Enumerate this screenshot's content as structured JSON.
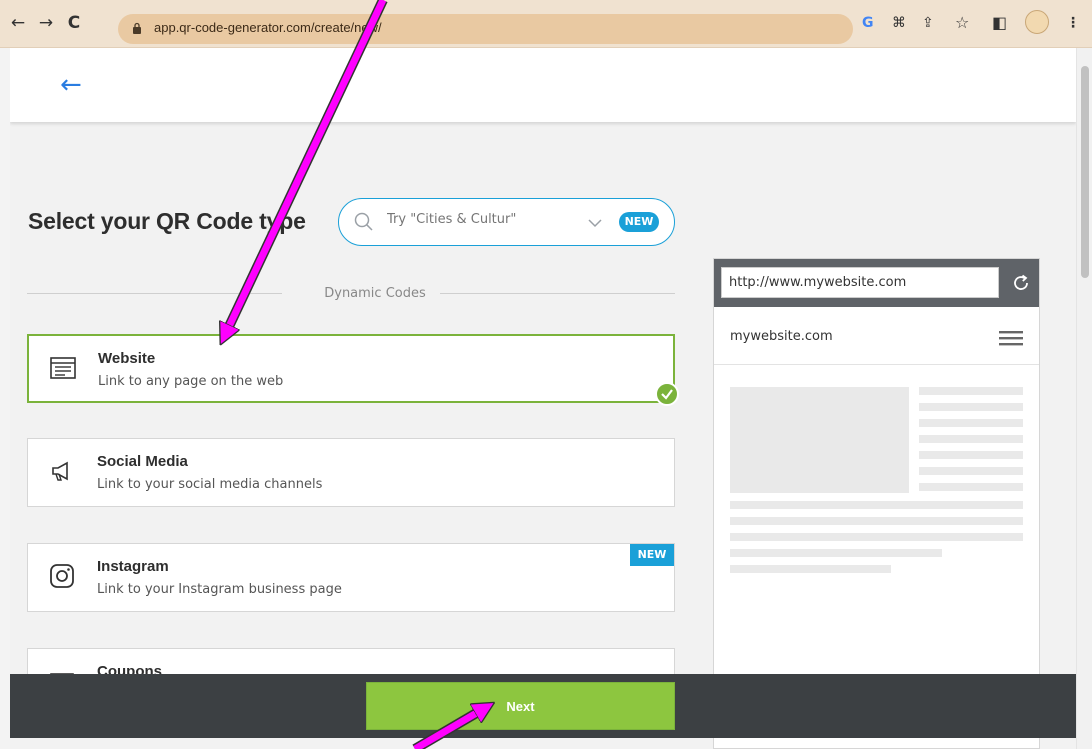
{
  "browser": {
    "url": "app.qr-code-generator.com/create/new/",
    "back_icon": "←",
    "forward_icon": "→",
    "reload_icon": "C",
    "google_icon": "G",
    "translate_icon": "⌘",
    "share_icon": "⇪",
    "star_icon": "☆",
    "sidepanel_icon": "◧",
    "menu_icon": "⋮"
  },
  "page": {
    "back_arrow": "←",
    "title": "Select your QR Code type",
    "search": {
      "placeholder": "Try \"Cities & Cultur\"",
      "badge": "NEW"
    },
    "divider_label": "Dynamic Codes",
    "types": [
      {
        "title": "Website",
        "subtitle": "Link to any page on the web",
        "icon": "website-icon",
        "selected": true
      },
      {
        "title": "Social Media",
        "subtitle": "Link to your social media channels",
        "icon": "megaphone-icon"
      },
      {
        "title": "Instagram",
        "subtitle": "Link to your Instagram business page",
        "icon": "instagram-icon",
        "badge": "NEW"
      },
      {
        "title": "Coupons",
        "icon": "coupon-icon"
      }
    ],
    "preview": {
      "url": "http://www.mywebsite.com",
      "site_name": "mywebsite.com"
    },
    "next_label": "Next"
  },
  "colors": {
    "accent_blue": "#1aa0d8",
    "selected_green": "#7bb33b",
    "next_green": "#8dc63f",
    "annotation_magenta": "#ff00ff"
  }
}
